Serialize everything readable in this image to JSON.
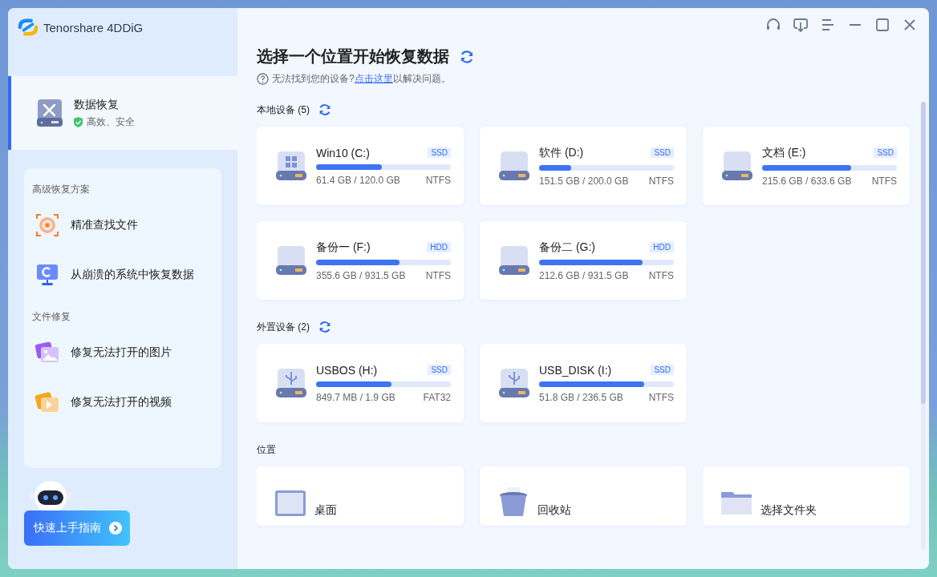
{
  "app": {
    "brand": "Tenorshare 4DDiG"
  },
  "sidebar": {
    "primary": {
      "title": "数据恢复",
      "subtitle": "高效、安全",
      "selected": true
    },
    "sections": [
      {
        "heading": "高级恢复方案",
        "items": [
          {
            "label": "精准查找文件",
            "selected": false
          },
          {
            "label": "从崩溃的系统中恢复数据",
            "selected": false
          }
        ]
      },
      {
        "heading": "文件修复",
        "items": [
          {
            "label": "修复无法打开的图片",
            "selected": false
          },
          {
            "label": "修复无法打开的视频",
            "selected": false
          }
        ]
      }
    ],
    "guide_button": "快速上手指南"
  },
  "main": {
    "title": "选择一个位置开始恢复数据",
    "help": {
      "text": "无法找到您的设备?",
      "link": "点击这里",
      "suffix": "以解决问题。"
    },
    "local": {
      "heading": "本地设备 (5)",
      "drives": [
        {
          "name": "Win10 (C:)",
          "type": "SSD",
          "level": 0.49,
          "usage": "61.4 GB / 120.0 GB",
          "fs": "NTFS",
          "kind": "system"
        },
        {
          "name": "软件 (D:)",
          "type": "SSD",
          "level": 0.24,
          "usage": "151.5 GB / 200.0 GB",
          "fs": "NTFS",
          "kind": "local"
        },
        {
          "name": "文档 (E:)",
          "type": "SSD",
          "level": 0.66,
          "usage": "215.6 GB / 633.6 GB",
          "fs": "NTFS",
          "kind": "local"
        },
        {
          "name": "备份一 (F:)",
          "type": "HDD",
          "level": 0.62,
          "usage": "355.6 GB / 931.5 GB",
          "fs": "NTFS",
          "kind": "local"
        },
        {
          "name": "备份二 (G:)",
          "type": "HDD",
          "level": 0.77,
          "usage": "212.6 GB / 931.5 GB",
          "fs": "NTFS",
          "kind": "local"
        }
      ]
    },
    "external": {
      "heading": "外置设备 (2)",
      "drives": [
        {
          "name": "USBOS (H:)",
          "type": "SSD",
          "level": 0.56,
          "usage": "849.7 MB / 1.9 GB",
          "fs": "FAT32",
          "kind": "usb"
        },
        {
          "name": "USB_DISK (I:)",
          "type": "SSD",
          "level": 0.78,
          "usage": "51.8 GB / 236.5 GB",
          "fs": "NTFS",
          "kind": "usb"
        }
      ]
    },
    "locations": {
      "heading": "位置",
      "items": [
        {
          "label": "桌面",
          "kind": "desktop"
        },
        {
          "label": "回收站",
          "kind": "recycle-bin"
        },
        {
          "label": "选择文件夹",
          "kind": "folder"
        }
      ]
    }
  }
}
